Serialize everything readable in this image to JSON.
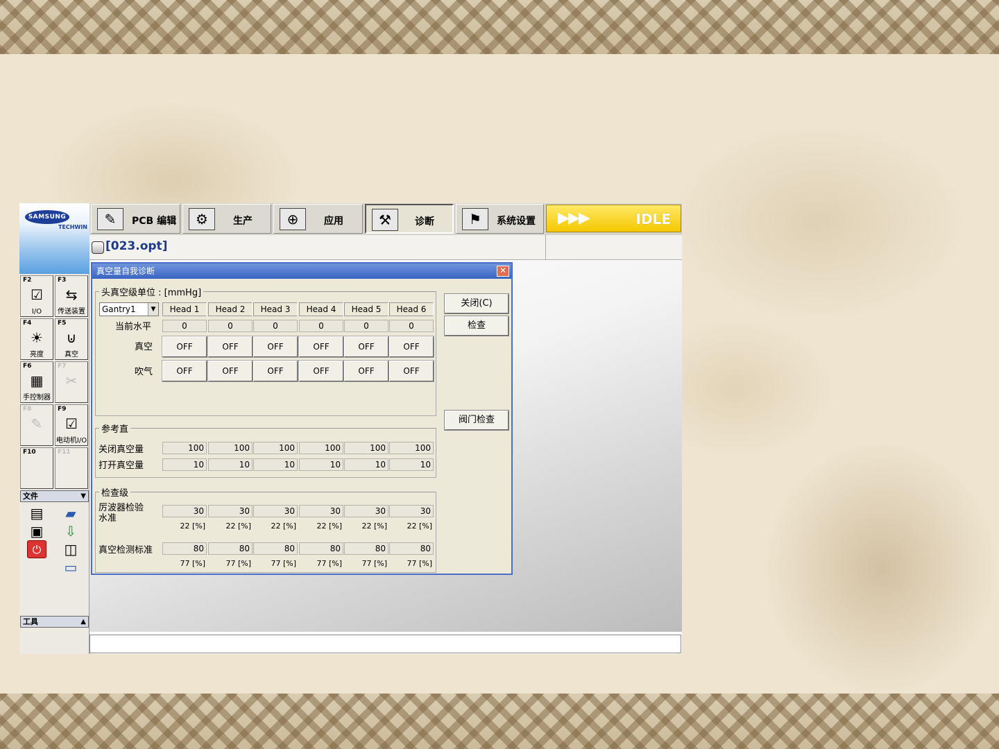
{
  "left_bar": {
    "logo": "SAMSUNG",
    "logo_sub": "TECHWIN",
    "fkeys": [
      {
        "key": "F2",
        "label": "I/O"
      },
      {
        "key": "F3",
        "label": "传送装置"
      },
      {
        "key": "F4",
        "label": "亮度"
      },
      {
        "key": "F5",
        "label": "真空"
      },
      {
        "key": "F6",
        "label": "手控制器"
      },
      {
        "key": "F7",
        "label": ""
      },
      {
        "key": "F8",
        "label": ""
      },
      {
        "key": "F9",
        "label": "电动机I/O"
      },
      {
        "key": "F10",
        "label": ""
      },
      {
        "key": "F11",
        "label": ""
      }
    ],
    "file_panel": "文件",
    "tools_panel": "工具"
  },
  "top_menu": {
    "items": [
      "PCB 编辑",
      "生产",
      "应用",
      "诊断",
      "系统设置"
    ],
    "active": "诊断",
    "status": "IDLE"
  },
  "file": {
    "name": "[023.opt]"
  },
  "dialog": {
    "title": "真空量自我诊断",
    "unit_group": "头真空级单位 : [mmHg]",
    "gantry": "Gantry1",
    "heads": [
      "Head 1",
      "Head 2",
      "Head 3",
      "Head 4",
      "Head 5",
      "Head 6"
    ],
    "current_level_label": "当前水平",
    "current_level": [
      "0",
      "0",
      "0",
      "0",
      "0",
      "0"
    ],
    "vacuum_label": "真空",
    "vacuum": [
      "OFF",
      "OFF",
      "OFF",
      "OFF",
      "OFF",
      "OFF"
    ],
    "blow_label": "吹气",
    "blow": [
      "OFF",
      "OFF",
      "OFF",
      "OFF",
      "OFF",
      "OFF"
    ],
    "ref_group": "参考直",
    "close_vac_label": "关闭真空量",
    "close_vac": [
      "100",
      "100",
      "100",
      "100",
      "100",
      "100"
    ],
    "open_vac_label": "打开真空量",
    "open_vac": [
      "10",
      "10",
      "10",
      "10",
      "10",
      "10"
    ],
    "check_group": "检查级",
    "filter_label_1": "厉波器检验",
    "filter_label_2": "水准",
    "filter": [
      "30",
      "30",
      "30",
      "30",
      "30",
      "30"
    ],
    "filter_pct": [
      "22 [%]",
      "22 [%]",
      "22 [%]",
      "22 [%]",
      "22 [%]",
      "22 [%]"
    ],
    "vac_std_label": "真空检测标准",
    "vac_std": [
      "80",
      "80",
      "80",
      "80",
      "80",
      "80"
    ],
    "vac_std_pct": [
      "77 [%]",
      "77 [%]",
      "77 [%]",
      "77 [%]",
      "77 [%]",
      "77 [%]"
    ],
    "btn_close": "关闭(C)",
    "btn_check": "检查",
    "btn_valve": "阀门检查"
  }
}
